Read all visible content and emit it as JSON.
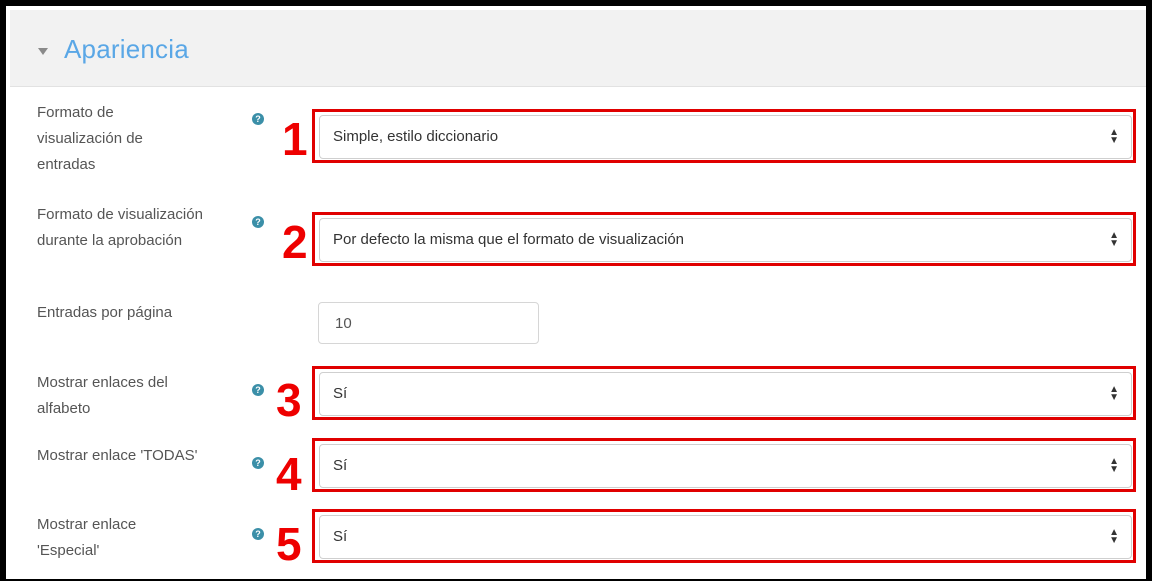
{
  "section": {
    "title": "Apariencia",
    "collapse_icon": "caret-down-icon"
  },
  "fields": [
    {
      "label": "Formato de visualización de entradas",
      "value": "Simple, estilo diccionario",
      "callout": "1",
      "help_icon": "question-circle-icon"
    },
    {
      "label": "Formato de visualización durante la aprobación",
      "value": "Por defecto la misma que el formato de visualización",
      "callout": "2",
      "help_icon": "question-circle-icon"
    },
    {
      "label": "Entradas por página",
      "value": "10"
    },
    {
      "label": "Mostrar enlaces del alfabeto",
      "value": "Sí",
      "callout": "3",
      "help_icon": "question-circle-icon"
    },
    {
      "label": "Mostrar enlace 'TODAS'",
      "value": "Sí",
      "callout": "4",
      "help_icon": "question-circle-icon"
    },
    {
      "label": "Mostrar enlace 'Especial'",
      "value": "Sí",
      "callout": "5",
      "help_icon": "question-circle-icon"
    }
  ],
  "colors": {
    "accent": "#5aa7e6",
    "callout_red": "#e00000",
    "help_icon": "#3b8fa8"
  }
}
